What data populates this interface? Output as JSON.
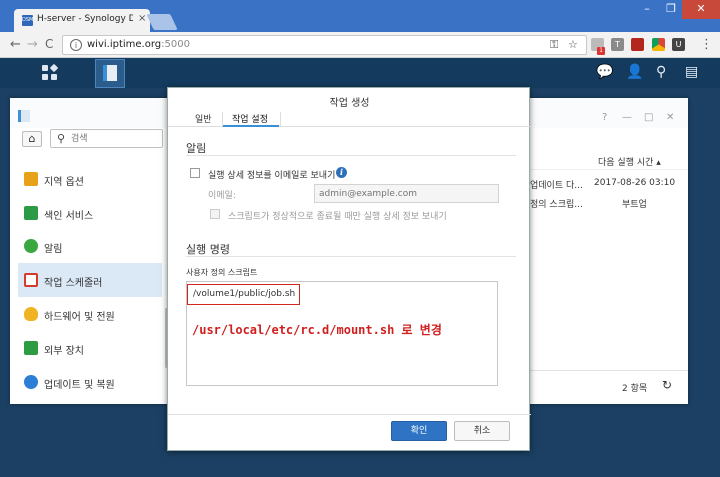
{
  "browser": {
    "tab_title": "H-server - Synology Di",
    "favicon_text": "DSM",
    "url_host": "wivi.iptime.org",
    "url_port": ":5000",
    "close_glyph": "×",
    "ext_badge": "1",
    "window_minimize": "–",
    "window_restore": "❐",
    "window_close": "✕",
    "back_glyph": "←",
    "forward_glyph": "→",
    "reload_glyph": "C",
    "info_glyph": "i",
    "key_glyph": "⚿",
    "star_glyph": "☆",
    "menu_glyph": "⋮",
    "ext_letters": [
      "",
      "T",
      "",
      "",
      "U"
    ]
  },
  "control_panel": {
    "search_placeholder": "검색",
    "sidebar": [
      {
        "label": "지역 옵션",
        "color": "#e8a21a"
      },
      {
        "label": "색인 서비스",
        "color": "#2d9b45"
      },
      {
        "label": "알림",
        "color": "#3aa83f"
      },
      {
        "label": "작업 스케줄러",
        "color": "#d53b2c"
      },
      {
        "label": "하드웨어 및 전원",
        "color": "#f0b321"
      },
      {
        "label": "외부 장치",
        "color": "#2e9c43"
      },
      {
        "label": "업데이트 및 복원",
        "color": "#2b7fd4"
      }
    ],
    "column_next_run": "다음 실행 시간 ▴",
    "rows": [
      {
        "task": "업데이트 다...",
        "next_run": "2017-08-26 03:10"
      },
      {
        "task": "정의 스크립...",
        "next_run": "부트업"
      }
    ],
    "item_count": "2 항목",
    "refresh_glyph": "↻",
    "window_controls": [
      "?",
      "—",
      "□",
      "✕"
    ]
  },
  "dialog": {
    "title": "작업 생성",
    "tabs": [
      "일반",
      "작업 설정"
    ],
    "notification_section": "알림",
    "email_checkbox_label": "실행 상세 정보를 이메일로 보내기",
    "email_label": "이메일:",
    "email_placeholder": "admin@example.com",
    "abnormal_only_label": "스크립트가 정상적으로 종료될 때만 실행 상세 정보 보내기",
    "command_section": "실행 명령",
    "script_label": "사용자 정의 스크립트",
    "script_value": "/volume1/public/job.sh",
    "annotation": "/usr/local/etc/rc.d/mount.sh 로 변경",
    "ok_label": "확인",
    "cancel_label": "취소"
  },
  "colors": {
    "accent": "#2f74c4",
    "highlight_box": "#d0281f"
  }
}
